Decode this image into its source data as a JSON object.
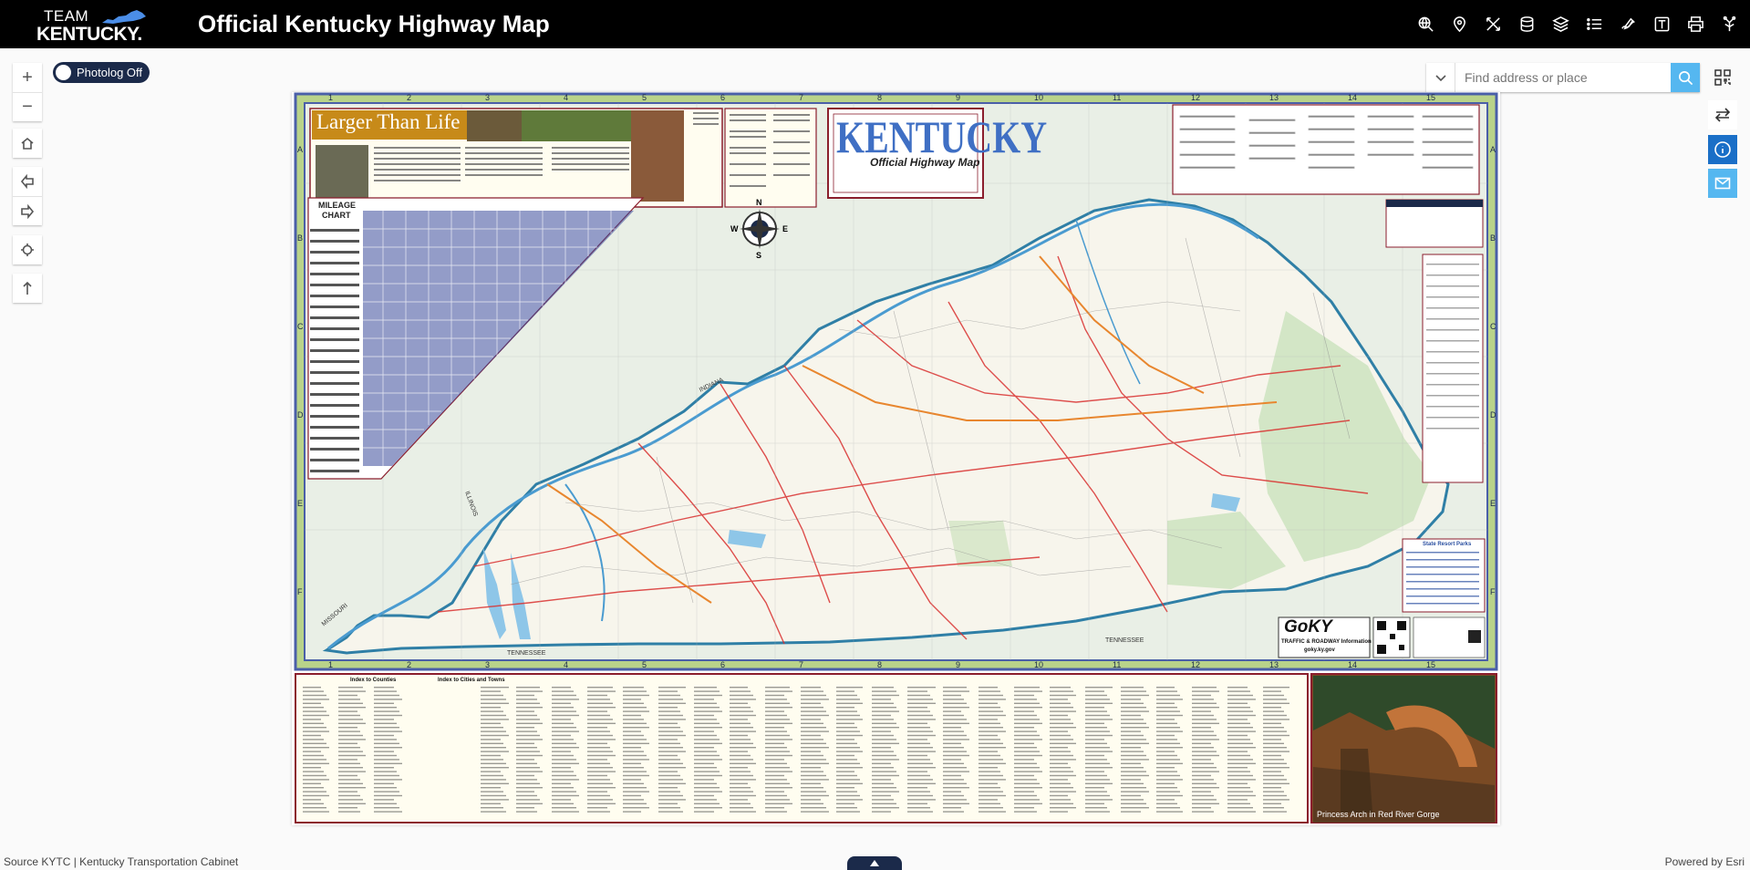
{
  "header": {
    "logo_top": "TEAM",
    "logo_bottom": "KENTUCKY.",
    "title": "Official Kentucky Highway Map",
    "tools": [
      {
        "icon": "globe-search-icon"
      },
      {
        "icon": "map-pin-icon"
      },
      {
        "icon": "measure-icon"
      },
      {
        "icon": "database-icon"
      },
      {
        "icon": "layers-icon"
      },
      {
        "icon": "list-icon"
      },
      {
        "icon": "draw-icon"
      },
      {
        "icon": "text-icon"
      },
      {
        "icon": "print-icon"
      },
      {
        "icon": "share-icon"
      }
    ]
  },
  "controls": {
    "zoom_in": "+",
    "zoom_out": "−"
  },
  "photolog": {
    "label": "Photolog Off"
  },
  "search": {
    "placeholder": "Find address or place"
  },
  "map": {
    "panel_title": "Larger Than Life",
    "kentucky_word": "KENTUCKY",
    "official_subtitle": "Official Highway Map",
    "mileage_title": "MILEAGE",
    "mileage_title2": "CHART",
    "goky_line1": "GoKY",
    "goky_line2": "TRAFFIC & ROADWAY Information",
    "goky_line3": "goky.ky.gov",
    "indiana": "INDIANA",
    "tennessee1": "TENNESSEE",
    "tennessee2": "TENNESSEE",
    "missouri": "MISSOURI",
    "illinois": "ILLINOIS",
    "index_counties": "Index to Counties",
    "index_cities": "Index to Cities and Towns",
    "state_parks": "State Resort Parks",
    "photo_caption": "Princess Arch in Red River Gorge",
    "compass_n": "N",
    "compass_s": "S",
    "compass_e": "E",
    "compass_w": "W",
    "grid_cols": [
      "1",
      "2",
      "3",
      "4",
      "5",
      "6",
      "7",
      "8",
      "9",
      "10",
      "11",
      "12",
      "13",
      "14",
      "15"
    ],
    "grid_rows": [
      "A",
      "B",
      "C",
      "D",
      "E",
      "F"
    ]
  },
  "footer": {
    "source": "Source KYTC | Kentucky Transportation Cabinet",
    "powered": "Powered by Esri"
  },
  "colors": {
    "header_bg": "#000000",
    "accent_blue": "#55b7f0",
    "toggle_navy": "#1b2a4a",
    "map_border_blue": "#4a5fa8",
    "map_frame_green": "#b9d38a",
    "kentucky_blue": "#3f6fc4",
    "panel_red": "#8b1e2d"
  }
}
